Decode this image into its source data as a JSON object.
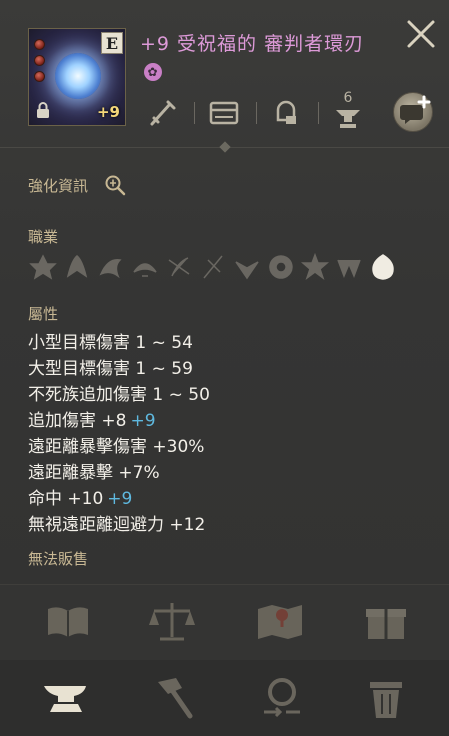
{
  "item": {
    "grade": "E",
    "refine": "+9",
    "title": "+9 受祝福的 審判者環刃",
    "title_badge": "✿"
  },
  "toolbar": {
    "icons": [
      "weapon-icon",
      "card-icon",
      "helmet-icon",
      "level-icon"
    ],
    "level_number": "6",
    "chat_icon": "chat-plus-icon"
  },
  "sections": {
    "enhance_info": "強化資訊",
    "job": "職業",
    "attributes": "屬性",
    "not_sellable": "無法販售"
  },
  "classes": [
    {
      "name": "class-icon-1",
      "active": false
    },
    {
      "name": "class-icon-2",
      "active": false
    },
    {
      "name": "class-icon-3",
      "active": false
    },
    {
      "name": "class-icon-4",
      "active": false
    },
    {
      "name": "class-icon-5",
      "active": false
    },
    {
      "name": "class-icon-6",
      "active": false
    },
    {
      "name": "class-icon-7",
      "active": false
    },
    {
      "name": "class-icon-8",
      "active": false
    },
    {
      "name": "class-icon-9",
      "active": false
    },
    {
      "name": "class-icon-10",
      "active": false
    },
    {
      "name": "class-icon-11",
      "active": true
    }
  ],
  "stats": [
    {
      "label": "小型目標傷害 1 ~ 54",
      "bonus": ""
    },
    {
      "label": "大型目標傷害 1 ~ 59",
      "bonus": ""
    },
    {
      "label": "不死族追加傷害 1 ~ 50",
      "bonus": ""
    },
    {
      "label": "追加傷害 +8",
      "bonus": "+9"
    },
    {
      "label": "遠距離暴擊傷害 +30%",
      "bonus": ""
    },
    {
      "label": "遠距離暴擊 +7%",
      "bonus": ""
    },
    {
      "label": "命中 +10",
      "bonus": "+9"
    },
    {
      "label": "無視遠距離迴避力 +12",
      "bonus": ""
    }
  ],
  "actions": [
    "book-icon",
    "scale-icon",
    "map-icon",
    "gift-box-icon"
  ],
  "bottom": [
    "anvil-icon",
    "hammer-icon",
    "magnify-swap-icon",
    "trash-icon"
  ],
  "colors": {
    "title": "#dd9ad8",
    "bonus": "#5fb9df",
    "section": "#c8b894",
    "refine": "#f4d77a"
  }
}
